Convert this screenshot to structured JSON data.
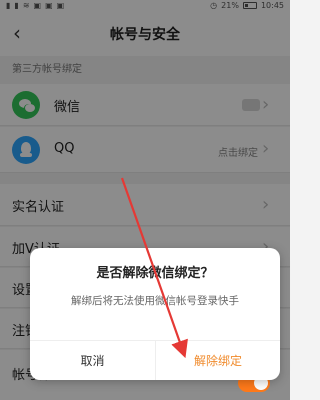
{
  "status": {
    "left_icons": [
      "signal-icon",
      "signal-icon",
      "wifi-icon",
      "camera-icon",
      "notification-icon",
      "notification-icon"
    ],
    "right_text": "21%",
    "time": "10:45"
  },
  "nav": {
    "back_icon": "chevron-left-icon",
    "title": "帐号与安全"
  },
  "section": {
    "third_party": "第三方帐号绑定"
  },
  "rows": {
    "wechat": {
      "label": "微信",
      "status": ""
    },
    "qq": {
      "label": "QQ",
      "status": "点击绑定"
    },
    "real_name": {
      "label": "实名认证"
    },
    "v_auth": {
      "label": "加V认证"
    },
    "settings_partial": {
      "label": "设置"
    },
    "logout_partial": {
      "label": "注销"
    },
    "protect_partial": {
      "label": "帐号保护"
    }
  },
  "dialog": {
    "title": "是否解除微信绑定？",
    "message": "解绑后将无法使用微信帐号登录快手",
    "cancel": "取消",
    "confirm": "解除绑定"
  },
  "colors": {
    "accent": "#f08a2b",
    "toggle_on": "#ff7a1a",
    "wechat": "#34c759",
    "qq": "#2da7ff",
    "annotation_arrow": "#e53935"
  }
}
